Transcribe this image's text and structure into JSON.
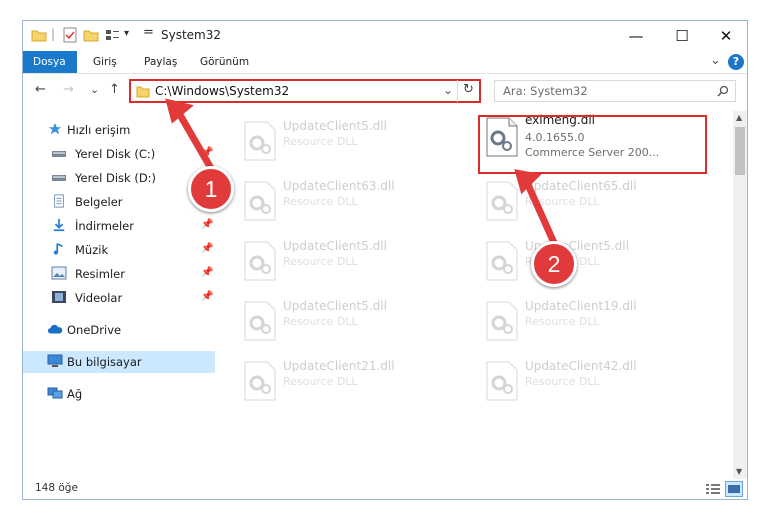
{
  "window": {
    "title": "System32",
    "controls": {
      "minimize": "—",
      "maximize": "☐",
      "close": "✕"
    }
  },
  "ribbon": {
    "tabs": [
      "Dosya",
      "Giriş",
      "Paylaş",
      "Görünüm"
    ],
    "active_tab": "Dosya",
    "help": "?",
    "collapse": "⌄"
  },
  "nav": {
    "back": "←",
    "forward": "→",
    "recent": "⌄",
    "up": "↑",
    "address": "C:\\Windows\\System32",
    "address_dropdown": "⌄",
    "refresh": "↻",
    "search_placeholder": "Ara: System32"
  },
  "sidebar": {
    "items": [
      {
        "label": "Hızlı erişim",
        "icon": "star-icon",
        "pinned": false
      },
      {
        "label": "Yerel Disk (C:)",
        "icon": "drive-icon",
        "pinned": true
      },
      {
        "label": "Yerel Disk (D:)",
        "icon": "drive-icon",
        "pinned": false
      },
      {
        "label": "Belgeler",
        "icon": "documents-icon",
        "pinned": true
      },
      {
        "label": "İndirmeler",
        "icon": "download-icon",
        "pinned": true
      },
      {
        "label": "Müzik",
        "icon": "music-icon",
        "pinned": true
      },
      {
        "label": "Resimler",
        "icon": "pictures-icon",
        "pinned": true
      },
      {
        "label": "Videolar",
        "icon": "videos-icon",
        "pinned": true
      },
      {
        "label": "OneDrive",
        "icon": "cloud-icon",
        "pinned": false
      },
      {
        "label": "Bu bilgisayar",
        "icon": "computer-icon",
        "pinned": false,
        "selected": true
      },
      {
        "label": "Ağ",
        "icon": "network-icon",
        "pinned": false
      }
    ],
    "pin_glyph": "📌"
  },
  "files": {
    "highlighted": {
      "name": "eximeng.dll",
      "version": "4.0.1655.0",
      "description": "Commerce Server 200..."
    },
    "left_column": [
      {
        "name": "UpdateClient5.dll",
        "type": "Resource DLL"
      },
      {
        "name": "UpdateClient63.dll",
        "type": "Resource DLL"
      },
      {
        "name": "UpdateClient5.dll",
        "type": "Resource DLL"
      },
      {
        "name": "UpdateClient5.dll",
        "type": "Resource DLL"
      },
      {
        "name": "UpdateClient21.dll",
        "type": "Resource DLL"
      }
    ],
    "right_column": [
      {
        "name": "UpdateClient65.dll",
        "type": "Resource DLL"
      },
      {
        "name": "UpdateClient5.dll",
        "type": "Resource DLL"
      },
      {
        "name": "UpdateClient19.dll",
        "type": "Resource DLL"
      },
      {
        "name": "UpdateClient42.dll",
        "type": "Resource DLL"
      }
    ]
  },
  "status": {
    "count": "148 öğe"
  },
  "callouts": [
    "1",
    "2"
  ],
  "colors": {
    "accent": "#1979ca",
    "highlight": "#dd2a2a",
    "selected": "#cce8ff"
  }
}
